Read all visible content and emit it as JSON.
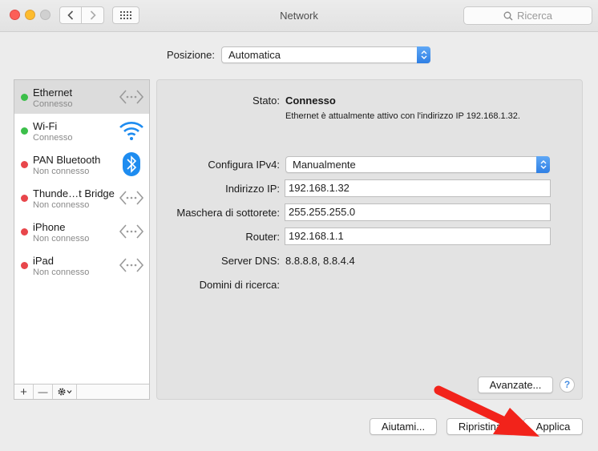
{
  "window": {
    "title": "Network"
  },
  "toolbar": {
    "search_placeholder": "Ricerca"
  },
  "location": {
    "label": "Posizione:",
    "value": "Automatica"
  },
  "services": [
    {
      "name": "Ethernet",
      "status": "Connesso",
      "dot_color": "#3cbf4a",
      "icon": "ethernet-arrows-icon",
      "selected": true
    },
    {
      "name": "Wi-Fi",
      "status": "Connesso",
      "dot_color": "#3cbf4a",
      "icon": "wifi-icon",
      "selected": false
    },
    {
      "name": "PAN Bluetooth",
      "status": "Non connesso",
      "dot_color": "#e8464b",
      "icon": "bluetooth-icon",
      "selected": false
    },
    {
      "name": "Thunde…t Bridge",
      "status": "Non connesso",
      "dot_color": "#e8464b",
      "icon": "ethernet-arrows-icon",
      "selected": false
    },
    {
      "name": "iPhone",
      "status": "Non connesso",
      "dot_color": "#e8464b",
      "icon": "ethernet-arrows-icon",
      "selected": false
    },
    {
      "name": "iPad",
      "status": "Non connesso",
      "dot_color": "#e8464b",
      "icon": "ethernet-arrows-icon",
      "selected": false
    }
  ],
  "sidebar_tools": {
    "add": "+",
    "remove": "—",
    "actions": "gear-icon"
  },
  "detail": {
    "status_label": "Stato:",
    "status_value": "Connesso",
    "status_desc": "Ethernet è attualmente attivo con l'indirizzo IP 192.168.1.32.",
    "configure_label": "Configura IPv4:",
    "configure_value": "Manualmente",
    "ip_label": "Indirizzo IP:",
    "ip_value": "192.168.1.32",
    "mask_label": "Maschera di sottorete:",
    "mask_value": "255.255.255.0",
    "router_label": "Router:",
    "router_value": "192.168.1.1",
    "dns_label": "Server DNS:",
    "dns_value": "8.8.8.8, 8.8.4.4",
    "search_domains_label": "Domini di ricerca:",
    "advanced_button": "Avanzate...",
    "help_button": "?"
  },
  "footer": {
    "help_button": "Aiutami...",
    "revert_button": "Ripristina",
    "apply_button": "Applica"
  },
  "colors": {
    "accent": "#2f7fe4",
    "arrow": "#f2231b",
    "connected": "#3cbf4a",
    "disconnected": "#e8464b"
  }
}
